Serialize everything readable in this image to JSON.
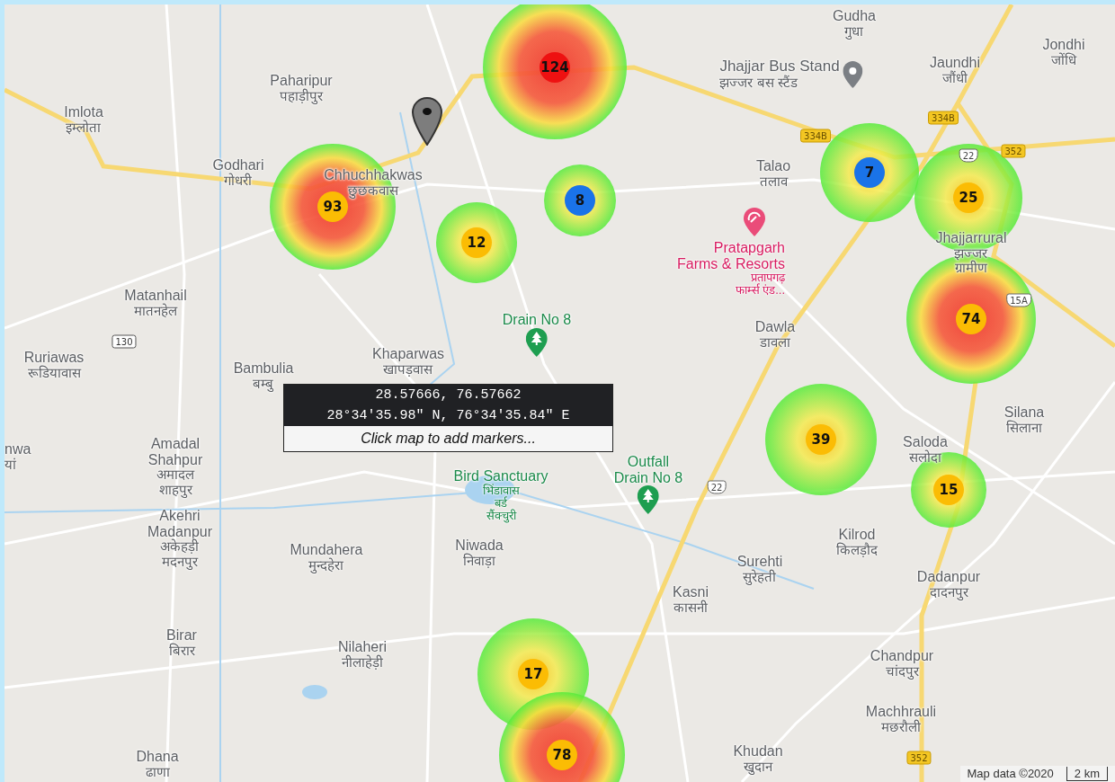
{
  "map": {
    "places": [
      {
        "lines": [
          "Gudha"
        ],
        "local": [
          "गुधा"
        ]
      },
      {
        "lines": [
          "Jaundhi"
        ],
        "local": [
          "जौंधी"
        ]
      },
      {
        "lines": [
          "Jondhi"
        ],
        "local": [
          "जोंधि"
        ]
      },
      {
        "lines": [
          "Paharipur"
        ],
        "local": [
          "पहाड़ीपुर"
        ]
      },
      {
        "lines": [
          "Imlota"
        ],
        "local": [
          "इम्लोता"
        ]
      },
      {
        "lines": [
          "Godhari"
        ],
        "local": [
          "गोधरी"
        ]
      },
      {
        "lines": [
          "Chhuchhakwas"
        ],
        "local": [
          "छुछकवास"
        ]
      },
      {
        "lines": [
          "Talao"
        ],
        "local": [
          "तलाव"
        ]
      },
      {
        "lines": [
          "Matanhail"
        ],
        "local": [
          "मातनहेल"
        ]
      },
      {
        "lines": [
          "Ruriawas"
        ],
        "local": [
          "रूडियावास"
        ]
      },
      {
        "lines": [
          "Bambulia"
        ],
        "local": [
          "बम्बु"
        ]
      },
      {
        "lines": [
          "Khaparwas"
        ],
        "local": [
          "खापड़वास"
        ]
      },
      {
        "lines": [
          "Dawla"
        ],
        "local": [
          "डावला"
        ]
      },
      {
        "lines": [
          "Jhajjarrural"
        ],
        "local": [
          "झज्जर",
          "ग्रामीण"
        ]
      },
      {
        "lines": [
          "Silana"
        ],
        "local": [
          "सिलाना"
        ]
      },
      {
        "lines": [
          "nwa"
        ],
        "local": [
          "यां"
        ]
      },
      {
        "lines": [
          "Amadal",
          "Shahpur"
        ],
        "local": [
          "अमादल",
          "शाहपुर"
        ]
      },
      {
        "lines": [
          "Saloda"
        ],
        "local": [
          "सलोदा"
        ]
      },
      {
        "lines": [
          "Akehri",
          "Madanpur"
        ],
        "local": [
          "अकेहड़ी",
          "मदनपुर"
        ]
      },
      {
        "lines": [
          "Mundahera"
        ],
        "local": [
          "मुन्दहेरा"
        ]
      },
      {
        "lines": [
          "Niwada"
        ],
        "local": [
          "निवाड़ा"
        ]
      },
      {
        "lines": [
          "Surehti"
        ],
        "local": [
          "सुरेहती"
        ]
      },
      {
        "lines": [
          "Kilrod"
        ],
        "local": [
          "किलड़ौद"
        ]
      },
      {
        "lines": [
          "Kasni"
        ],
        "local": [
          "कासनी"
        ]
      },
      {
        "lines": [
          "Dadanpur"
        ],
        "local": [
          "दादनपुर"
        ]
      },
      {
        "lines": [
          "Birar"
        ],
        "local": [
          "बिरार"
        ]
      },
      {
        "lines": [
          "Nilaheri"
        ],
        "local": [
          "नीलाहेड़ी"
        ]
      },
      {
        "lines": [
          "Chandpur"
        ],
        "local": [
          "चांदपुर"
        ]
      },
      {
        "lines": [
          "Machhrauli"
        ],
        "local": [
          "मछरौली"
        ]
      },
      {
        "lines": [
          "Dhana"
        ],
        "local": [
          "ढाणा"
        ]
      },
      {
        "lines": [
          "Khudan"
        ],
        "local": [
          "खुदान"
        ]
      }
    ],
    "pois": [
      {
        "kind": "bus",
        "lines": [
          "Jhajjar Bus Stand"
        ],
        "local": [
          "झज्जर बस स्टैंड"
        ]
      },
      {
        "kind": "resort",
        "lines": [
          "Pratapgarh",
          "Farms & Resorts"
        ],
        "local": [
          "प्रतापगढ़",
          "फार्म्स एंड..."
        ]
      },
      {
        "kind": "park",
        "lines": [
          "Drain No 8"
        ]
      },
      {
        "kind": "park",
        "lines": [
          "Outfall",
          "Drain No 8"
        ]
      },
      {
        "kind": "sanctuary",
        "lines": [
          "Bird Sanctuary"
        ],
        "local": [
          "भिंडावास",
          "बर्ड",
          "सैंक्चुरी"
        ]
      }
    ],
    "road_shields": [
      {
        "label": "130",
        "kind": "state"
      },
      {
        "label": "334B",
        "kind": "national"
      },
      {
        "label": "334B",
        "kind": "national"
      },
      {
        "label": "22",
        "kind": "shield"
      },
      {
        "label": "352",
        "kind": "national"
      },
      {
        "label": "15A",
        "kind": "shield"
      },
      {
        "label": "22",
        "kind": "shield"
      },
      {
        "label": "352",
        "kind": "national"
      }
    ],
    "clusters": [
      {
        "count": "124",
        "color": "#ee1111"
      },
      {
        "count": "93",
        "color": "#fbbc04"
      },
      {
        "count": "12",
        "color": "#fbbc04"
      },
      {
        "count": "8",
        "color": "#1a73e8"
      },
      {
        "count": "7",
        "color": "#1a73e8"
      },
      {
        "count": "25",
        "color": "#fbbc04"
      },
      {
        "count": "74",
        "color": "#fbbc04"
      },
      {
        "count": "39",
        "color": "#fbbc04"
      },
      {
        "count": "15",
        "color": "#fbbc04"
      },
      {
        "count": "17",
        "color": "#fbbc04"
      },
      {
        "count": "78",
        "color": "#fbbc04"
      }
    ],
    "popup": {
      "decimal": "28.57666, 76.57662",
      "dms": "28°34'35.98\" N, 76°34'35.84\" E",
      "hint": "Click map to add markers..."
    },
    "attribution": {
      "text": "Map data ©2020",
      "scale": "2 km"
    }
  }
}
